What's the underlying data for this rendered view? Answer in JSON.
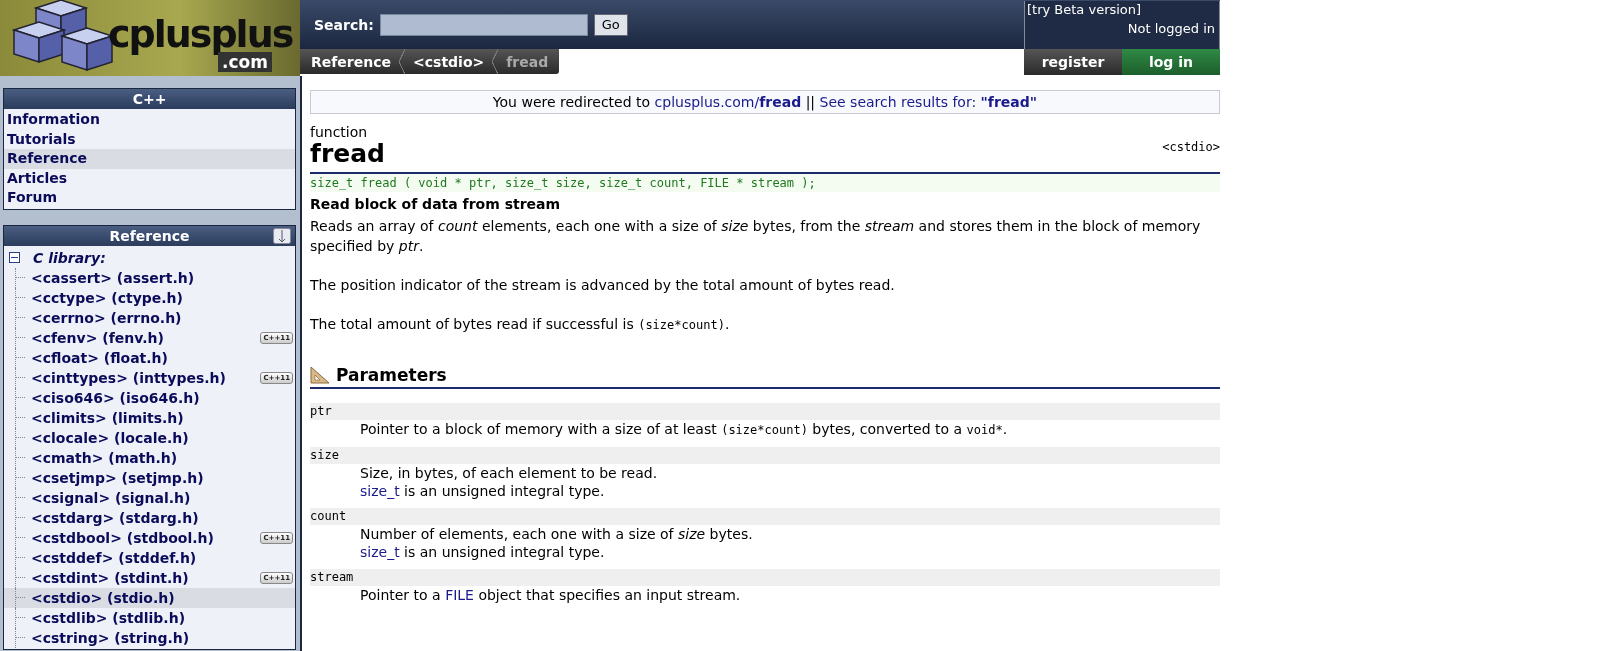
{
  "header": {
    "logo": {
      "name": "cplusplus",
      "domain": ".com"
    },
    "search": {
      "label": "Search:",
      "button": "Go"
    },
    "beta_link": "[try Beta version]",
    "login_status": "Not logged in",
    "breadcrumbs": [
      {
        "label": "Reference",
        "current": false
      },
      {
        "label": "<cstdio>",
        "current": false
      },
      {
        "label": "fread",
        "current": true
      }
    ],
    "account_buttons": [
      {
        "label": "register",
        "kind": "register"
      },
      {
        "label": "log in",
        "kind": "login"
      }
    ]
  },
  "sidebar": {
    "menu": {
      "title": "C++",
      "items": [
        {
          "label": "Information",
          "selected": false
        },
        {
          "label": "Tutorials",
          "selected": false
        },
        {
          "label": "Reference",
          "selected": true
        },
        {
          "label": "Articles",
          "selected": false
        },
        {
          "label": "Forum",
          "selected": false
        }
      ]
    },
    "reference": {
      "title": "Reference",
      "tree": {
        "label": "C library:",
        "expanded": true,
        "children": [
          {
            "label": "<cassert> (assert.h)",
            "selected": false
          },
          {
            "label": "<cctype> (ctype.h)",
            "selected": false
          },
          {
            "label": "<cerrno> (errno.h)",
            "selected": false
          },
          {
            "label": "<cfenv> (fenv.h)",
            "selected": false,
            "badge": "C++11"
          },
          {
            "label": "<cfloat> (float.h)",
            "selected": false
          },
          {
            "label": "<cinttypes> (inttypes.h)",
            "selected": false,
            "badge": "C++11"
          },
          {
            "label": "<ciso646> (iso646.h)",
            "selected": false
          },
          {
            "label": "<climits> (limits.h)",
            "selected": false
          },
          {
            "label": "<clocale> (locale.h)",
            "selected": false
          },
          {
            "label": "<cmath> (math.h)",
            "selected": false
          },
          {
            "label": "<csetjmp> (setjmp.h)",
            "selected": false
          },
          {
            "label": "<csignal> (signal.h)",
            "selected": false
          },
          {
            "label": "<cstdarg> (stdarg.h)",
            "selected": false
          },
          {
            "label": "<cstdbool> (stdbool.h)",
            "selected": false,
            "badge": "C++11"
          },
          {
            "label": "<cstddef> (stddef.h)",
            "selected": false
          },
          {
            "label": "<cstdint> (stdint.h)",
            "selected": false,
            "badge": "C++11"
          },
          {
            "label": "<cstdio> (stdio.h)",
            "selected": true
          },
          {
            "label": "<cstdlib> (stdlib.h)",
            "selected": false
          },
          {
            "label": "<cstring> (string.h)",
            "selected": false
          }
        ]
      }
    }
  },
  "content": {
    "notice": [
      {
        "kind": "text",
        "text": "You were redirected to "
      },
      {
        "kind": "link",
        "text": "cplusplus.com/**fread**"
      },
      {
        "kind": "text",
        "text": " || "
      },
      {
        "kind": "link",
        "text": "See search results for: **\"fread\"**"
      }
    ],
    "entity_kind": "function",
    "title": "fread",
    "header": "<cstdio>",
    "prototype": "size_t fread ( void * ptr, size_t size, size_t count, FILE * stream );",
    "summary": "Read block of data from stream",
    "paragraphs": [
      [
        {
          "kind": "text",
          "text": "Reads an array of *count* elements, each one with a size of *size* bytes, from the *stream* and stores them in the block of memory specified by *ptr*."
        }
      ],
      [
        {
          "kind": "text",
          "text": "The position indicator of the stream is advanced by the total amount of bytes read."
        }
      ],
      [
        {
          "kind": "text",
          "text": "The total amount of bytes read if successful is "
        },
        {
          "kind": "code",
          "text": "(size*count)"
        },
        {
          "kind": "text",
          "text": "."
        }
      ]
    ],
    "parameters": {
      "title": "Parameters",
      "items": [
        {
          "name": "ptr",
          "lines": [
            [
              {
                "kind": "text",
                "text": "Pointer to a block of memory with a size of at least "
              },
              {
                "kind": "code",
                "text": "(size*count)"
              },
              {
                "kind": "text",
                "text": " bytes, converted to a "
              },
              {
                "kind": "code",
                "text": "void*"
              },
              {
                "kind": "text",
                "text": "."
              }
            ]
          ]
        },
        {
          "name": "size",
          "lines": [
            [
              {
                "kind": "text",
                "text": "Size, in bytes, of each element to be read."
              }
            ],
            [
              {
                "kind": "link",
                "text": "size_t"
              },
              {
                "kind": "text",
                "text": " is an unsigned integral type."
              }
            ]
          ]
        },
        {
          "name": "count",
          "lines": [
            [
              {
                "kind": "text",
                "text": "Number of elements, each one with a size of *size* bytes."
              }
            ],
            [
              {
                "kind": "link",
                "text": "size_t"
              },
              {
                "kind": "text",
                "text": " is an unsigned integral type."
              }
            ]
          ]
        },
        {
          "name": "stream",
          "lines": [
            [
              {
                "kind": "text",
                "text": "Pointer to a "
              },
              {
                "kind": "link",
                "text": "FILE"
              },
              {
                "kind": "text",
                "text": " object that specifies an input stream."
              }
            ]
          ]
        }
      ]
    }
  }
}
